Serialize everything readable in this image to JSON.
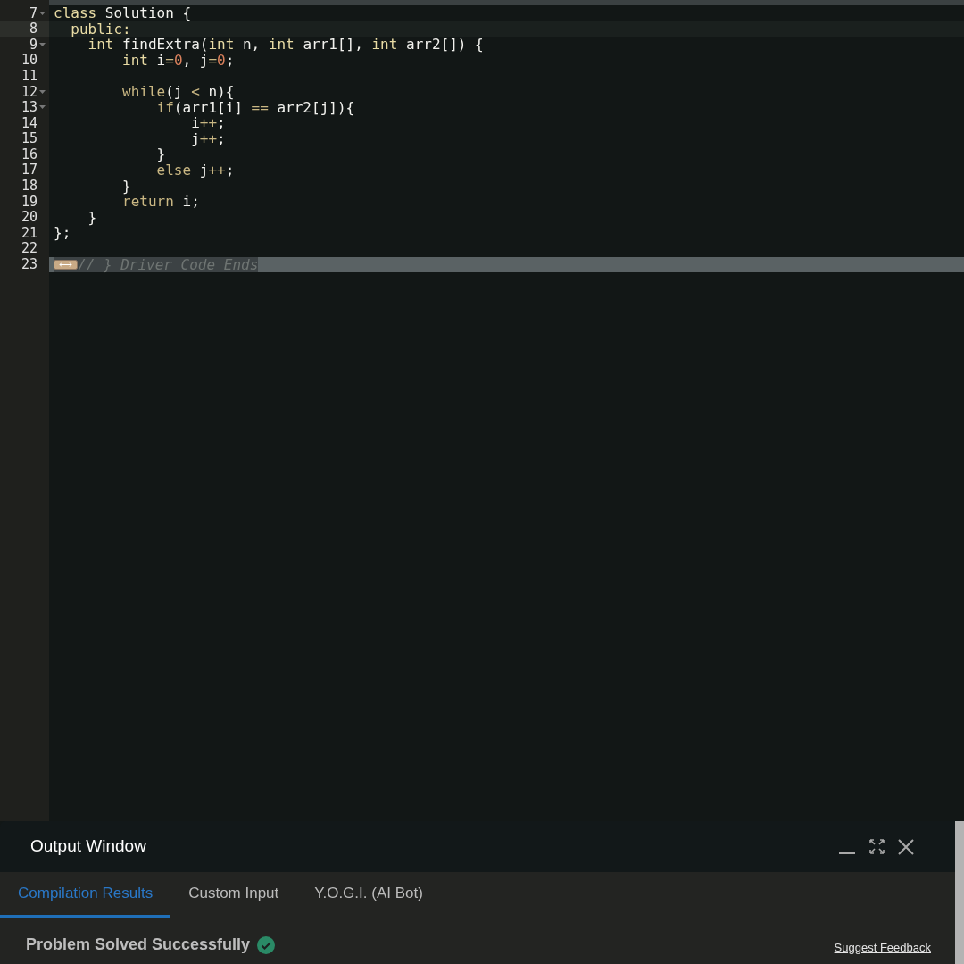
{
  "editor": {
    "lines": [
      {
        "number": "7",
        "foldable": true,
        "active": false,
        "folded": false,
        "tokens": [
          {
            "kind": "keyword",
            "text": "class"
          },
          {
            "kind": "plain",
            "text": " Solution {"
          }
        ]
      },
      {
        "number": "8",
        "foldable": false,
        "active": true,
        "folded": false,
        "tokens": [
          {
            "kind": "keyword",
            "text": "  public:"
          }
        ]
      },
      {
        "number": "9",
        "foldable": true,
        "active": false,
        "folded": false,
        "tokens": [
          {
            "kind": "keyword",
            "text": "    int"
          },
          {
            "kind": "plain",
            "text": " findExtra("
          },
          {
            "kind": "keyword",
            "text": "int"
          },
          {
            "kind": "plain",
            "text": " n, "
          },
          {
            "kind": "keyword",
            "text": "int"
          },
          {
            "kind": "plain",
            "text": " arr1[], "
          },
          {
            "kind": "keyword",
            "text": "int"
          },
          {
            "kind": "plain",
            "text": " arr2[]) {"
          }
        ]
      },
      {
        "number": "10",
        "foldable": false,
        "active": false,
        "folded": false,
        "tokens": [
          {
            "kind": "keyword",
            "text": "        int"
          },
          {
            "kind": "plain",
            "text": " i"
          },
          {
            "kind": "operator",
            "text": "="
          },
          {
            "kind": "number",
            "text": "0"
          },
          {
            "kind": "plain",
            "text": ", j"
          },
          {
            "kind": "operator",
            "text": "="
          },
          {
            "kind": "number",
            "text": "0"
          },
          {
            "kind": "plain",
            "text": ";"
          }
        ]
      },
      {
        "number": "11",
        "foldable": false,
        "active": false,
        "folded": false
      },
      {
        "number": "12",
        "foldable": true,
        "active": false,
        "folded": false,
        "tokens": [
          {
            "kind": "control",
            "text": "        while"
          },
          {
            "kind": "plain",
            "text": "(j "
          },
          {
            "kind": "operator",
            "text": "<"
          },
          {
            "kind": "plain",
            "text": " n){"
          }
        ]
      },
      {
        "number": "13",
        "foldable": true,
        "active": false,
        "folded": false,
        "tokens": [
          {
            "kind": "control",
            "text": "            if"
          },
          {
            "kind": "plain",
            "text": "(arr1[i] "
          },
          {
            "kind": "operator",
            "text": "=="
          },
          {
            "kind": "plain",
            "text": " arr2[j]){"
          }
        ]
      },
      {
        "number": "14",
        "foldable": false,
        "active": false,
        "folded": false,
        "tokens": [
          {
            "kind": "plain",
            "text": "                i"
          },
          {
            "kind": "operator",
            "text": "++"
          },
          {
            "kind": "plain",
            "text": ";"
          }
        ]
      },
      {
        "number": "15",
        "foldable": false,
        "active": false,
        "folded": false,
        "tokens": [
          {
            "kind": "plain",
            "text": "                j"
          },
          {
            "kind": "operator",
            "text": "++"
          },
          {
            "kind": "plain",
            "text": ";"
          }
        ]
      },
      {
        "number": "16",
        "foldable": false,
        "active": false,
        "folded": false,
        "tokens": [
          {
            "kind": "plain",
            "text": "            }"
          }
        ]
      },
      {
        "number": "17",
        "foldable": false,
        "active": false,
        "folded": false,
        "tokens": [
          {
            "kind": "control",
            "text": "            else"
          },
          {
            "kind": "plain",
            "text": " j"
          },
          {
            "kind": "operator",
            "text": "++"
          },
          {
            "kind": "plain",
            "text": ";"
          }
        ]
      },
      {
        "number": "18",
        "foldable": false,
        "active": false,
        "folded": false,
        "tokens": [
          {
            "kind": "plain",
            "text": "        }"
          }
        ]
      },
      {
        "number": "19",
        "foldable": false,
        "active": false,
        "folded": false,
        "tokens": [
          {
            "kind": "control",
            "text": "        return"
          },
          {
            "kind": "plain",
            "text": " i;"
          }
        ]
      },
      {
        "number": "20",
        "foldable": false,
        "active": false,
        "folded": false,
        "tokens": [
          {
            "kind": "plain",
            "text": "    }"
          }
        ]
      },
      {
        "number": "21",
        "foldable": false,
        "active": false,
        "folded": false,
        "tokens": [
          {
            "kind": "plain",
            "text": "};"
          }
        ]
      },
      {
        "number": "22",
        "foldable": false,
        "active": false,
        "folded": false
      },
      {
        "number": "23",
        "foldable": false,
        "active": false,
        "folded": true,
        "tokens": [
          {
            "kind": "comment",
            "text": "// } Driver Code Ends"
          }
        ]
      }
    ]
  },
  "output_window": {
    "title": "Output Window",
    "tabs": [
      {
        "label": "Compilation Results",
        "selected": true
      },
      {
        "label": "Custom Input",
        "selected": false
      },
      {
        "label": "Y.O.G.I. (AI Bot)",
        "selected": false
      }
    ],
    "status": "Problem Solved Successfully",
    "link": "Suggest Feedback"
  }
}
